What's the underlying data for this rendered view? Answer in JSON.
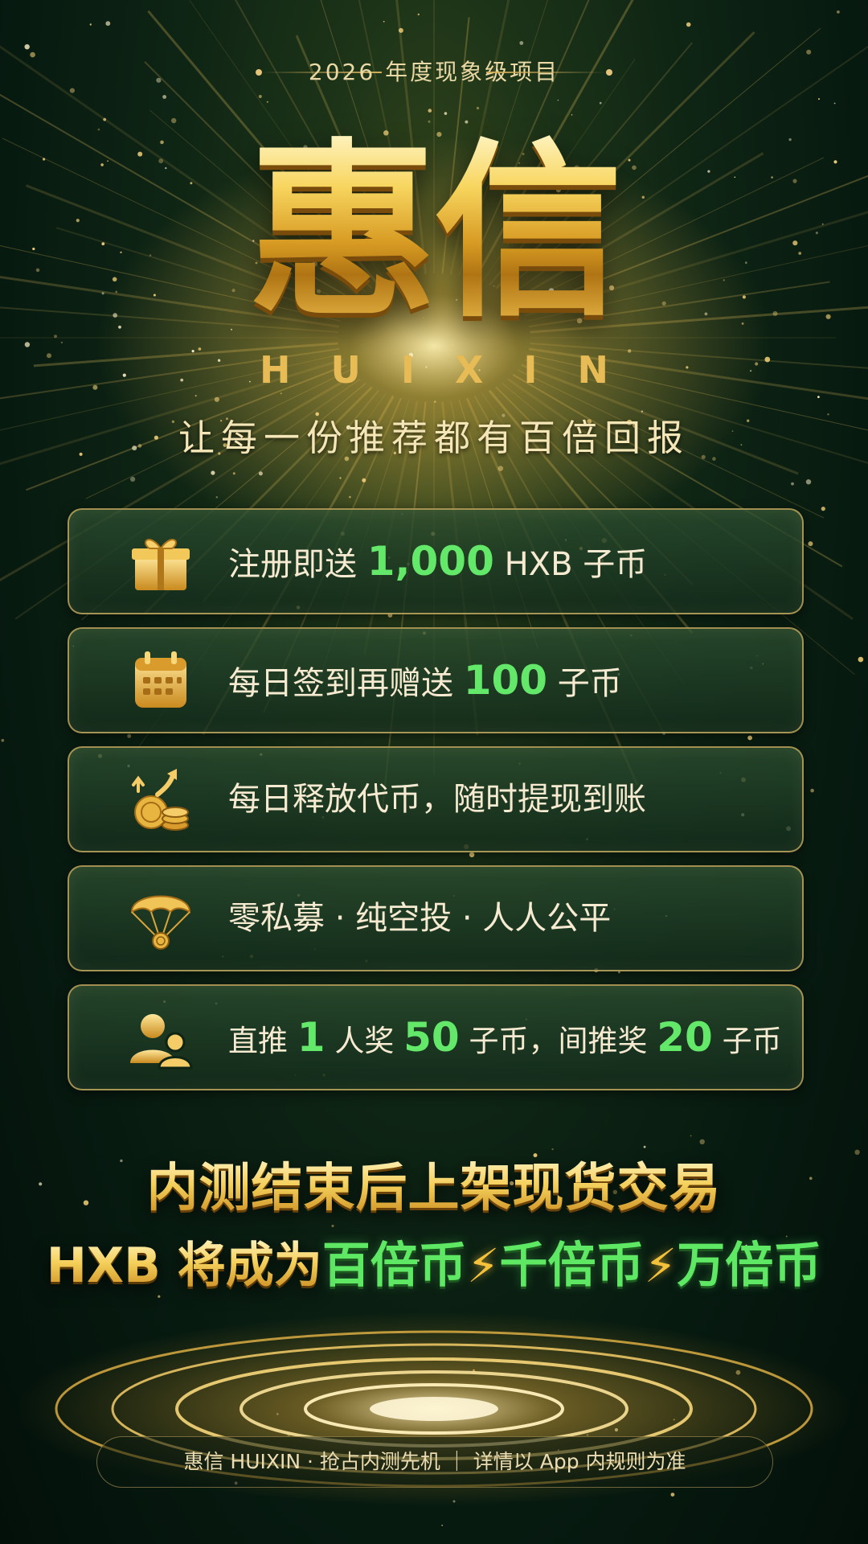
{
  "header": {
    "tagline": "2026 年度现象级项目",
    "logo": "惠信",
    "logo_latin": "HUIXIN",
    "slogan": "让每一份推荐都有百倍回报"
  },
  "features": [
    {
      "icon": "gift-box-icon",
      "pre": "注册即送 ",
      "hl": "1,000",
      "post": " HXB 子币"
    },
    {
      "icon": "calendar-icon",
      "pre": "每日签到再赠送 ",
      "hl": "100",
      "post": " 子币"
    },
    {
      "icon": "coins-growth-icon",
      "text": "每日释放代币，随时提现到账"
    },
    {
      "icon": "parachute-airdrop-icon",
      "text": "零私募 · 纯空投 · 人人公平"
    },
    {
      "icon": "referral-users-icon",
      "p1": "直推 ",
      "n1": "1",
      "p2": " 人奖 ",
      "n2": "50",
      "p3": " 子币，间推奖 ",
      "n3": "20",
      "p4": " 子币"
    }
  ],
  "cta": {
    "line1": "内测结束后上架现货交易",
    "line2_prefix": "HXB 将成为",
    "tier1": "百倍币",
    "tier2": "千倍币",
    "tier3": "万倍币",
    "bolt": "⚡"
  },
  "footer": {
    "text": "惠信 HUIXIN · 抢占内测先机 ｜ 详情以 App 内规则为准"
  },
  "colors": {
    "gold": "#f3cf5f",
    "green_highlight": "#63e86a",
    "background": "#0e2414"
  }
}
